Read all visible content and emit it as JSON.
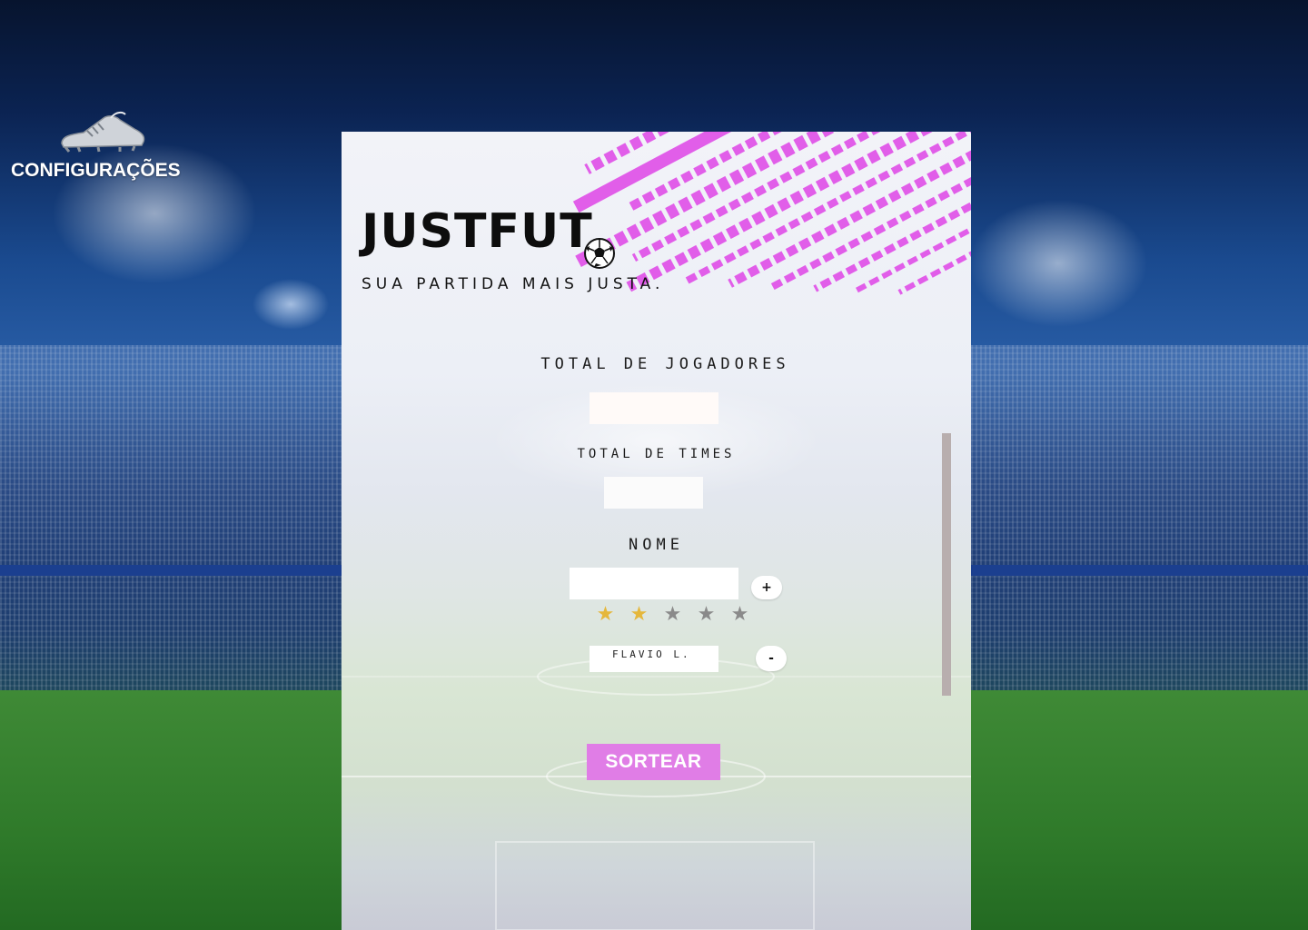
{
  "sidebar": {
    "config_label": "CONFIGURAÇÕES",
    "config_icon": "soccer-boot-icon"
  },
  "brand": {
    "title": "JUSTFUT",
    "tagline": "SUA PARTIDA MAIS JUSTA.",
    "icon": "soccer-ball-icon"
  },
  "form": {
    "players_label": "TOTAL DE JOGADORES",
    "players_value": "",
    "teams_label": "TOTAL DE TIMES",
    "teams_value": "",
    "name_label": "NOME",
    "name_value": "",
    "add_label": "+",
    "rating": {
      "value": 2,
      "max": 5,
      "symbol": "★"
    },
    "players": [
      {
        "name": "FLAVIO L.",
        "remove_label": "-"
      }
    ],
    "submit_label": "SORTEAR"
  },
  "colors": {
    "accent": "#e07de6",
    "star_on": "#e5b73b",
    "star_off": "#8a8a8a",
    "scrollbar": "#b8aeae"
  }
}
